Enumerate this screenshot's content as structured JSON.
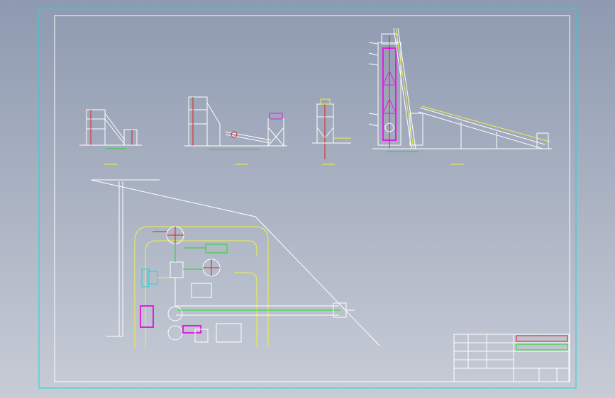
{
  "colors": {
    "background_top": "#8e9ab0",
    "background_bottom": "#c7ccd6",
    "outer_frame": "#22d4d4",
    "inner_frame": "#ffffff",
    "line_main": "#ffffff",
    "line_yellow": "#f2f23c",
    "line_red": "#e02020",
    "line_green": "#22d822",
    "line_magenta": "#e020e0",
    "line_cyan": "#22d4d4"
  },
  "views": {
    "view_a_label": "",
    "view_b_label": "",
    "view_c_label": "",
    "view_d_label": ""
  },
  "plan": {
    "road_label": ""
  },
  "title_block": {
    "drawing_title": "",
    "scale": "",
    "sheet_label": ""
  }
}
